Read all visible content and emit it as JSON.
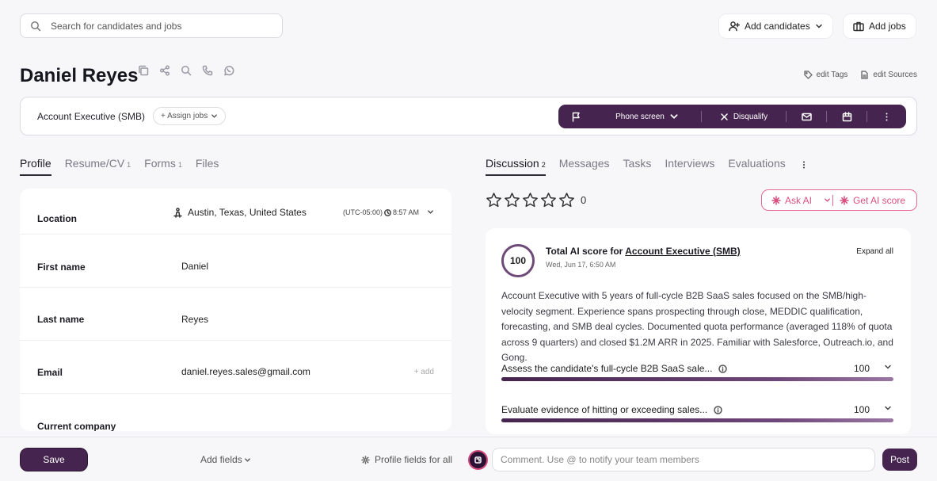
{
  "header": {
    "search_placeholder": "Search for candidates and jobs",
    "add_candidates_label": "Add candidates",
    "add_jobs_label": "Add jobs"
  },
  "candidate": {
    "name": "Daniel Reyes",
    "edit_tags_label": "edit Tags",
    "edit_sources_label": "edit Sources"
  },
  "job_bar": {
    "job_title": "Account Executive (SMB)",
    "assign_jobs_label": "+ Assign jobs",
    "stage_label": "Phone screen",
    "disqualify_label": "Disqualify"
  },
  "left_tabs": [
    {
      "label": "Profile",
      "count": ""
    },
    {
      "label": "Resume/CV",
      "count": "1"
    },
    {
      "label": "Forms",
      "count": "1"
    },
    {
      "label": "Files",
      "count": ""
    }
  ],
  "profile": {
    "location_label": "Location",
    "location_value": "Austin, Texas, United States",
    "timezone": "(UTC-05:00)",
    "local_time": "8:57 AM",
    "first_name_label": "First name",
    "first_name_value": "Daniel",
    "last_name_label": "Last name",
    "last_name_value": "Reyes",
    "email_label": "Email",
    "email_value": "daniel.reyes.sales@gmail.com",
    "email_add_label": "+ add",
    "current_company_label": "Current company"
  },
  "right_tabs": [
    {
      "label": "Discussion",
      "count": "2"
    },
    {
      "label": "Messages",
      "count": ""
    },
    {
      "label": "Tasks",
      "count": ""
    },
    {
      "label": "Interviews",
      "count": ""
    },
    {
      "label": "Evaluations",
      "count": ""
    }
  ],
  "rating": {
    "stars_filled": 0,
    "stars_total": 5,
    "score_text": "0"
  },
  "ai": {
    "ask_ai_label": "Ask AI",
    "get_ai_score_label": "Get AI score",
    "total_score": "100",
    "title_prefix": "Total AI score for",
    "title_job": "Account Executive (SMB)",
    "date": "Wed, Jun 17, 6:50 AM",
    "expand_all_label": "Expand all",
    "summary": "Account Executive with 5 years of full-cycle B2B SaaS sales focused on the SMB/high-velocity segment. Experience spans prospecting through close, MEDDIC qualification, forecasting, and SMB deal cycles. Documented quota performance (averaged 118% of quota across 9 quarters) and closed $1.2M ARR in 2025. Familiar with Salesforce, Outreach.io, and Gong.",
    "criteria": [
      {
        "text": "Assess the candidate's full-cycle B2B SaaS sale...",
        "score": "100",
        "fraction": 1.0
      },
      {
        "text": "Evaluate evidence of hitting or exceeding sales...",
        "score": "100",
        "fraction": 1.0
      }
    ]
  },
  "footer": {
    "save_label": "Save",
    "add_fields_label": "Add fields",
    "profile_fields_label": "Profile fields for all",
    "comment_placeholder": "Comment. Use @ to notify your team members",
    "post_label": "Post"
  },
  "colors": {
    "brand": "#45244f",
    "accent_pink": "#d9507e"
  }
}
